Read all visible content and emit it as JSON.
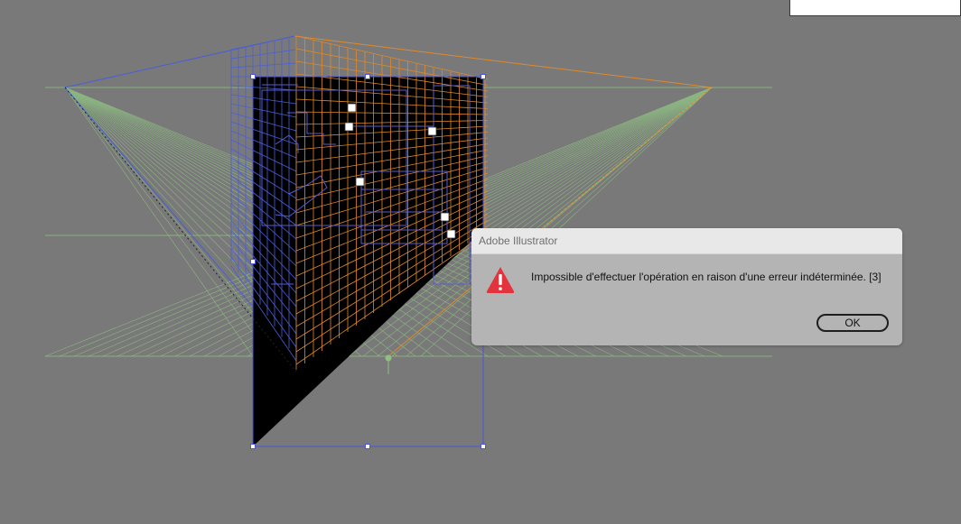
{
  "dialog": {
    "title": "Adobe Illustrator",
    "icon": "warning-triangle-icon",
    "message": "Impossible d'effectuer l'opération en raison d'une erreur indéterminée. [3]",
    "ok_label": "OK"
  },
  "colors": {
    "canvas_background": "#797979",
    "left_grid": "#4a5ed8",
    "right_grid": "#e08a2a",
    "ground_grid": "#8fc083",
    "horizon_line": "#8fc083",
    "artwork_fill": "#000000",
    "selection": "#4b55d6",
    "warning_red": "#e3343d",
    "dialog_background": "#b4b4b4",
    "dialog_titlebar": "#e8e8e8"
  }
}
